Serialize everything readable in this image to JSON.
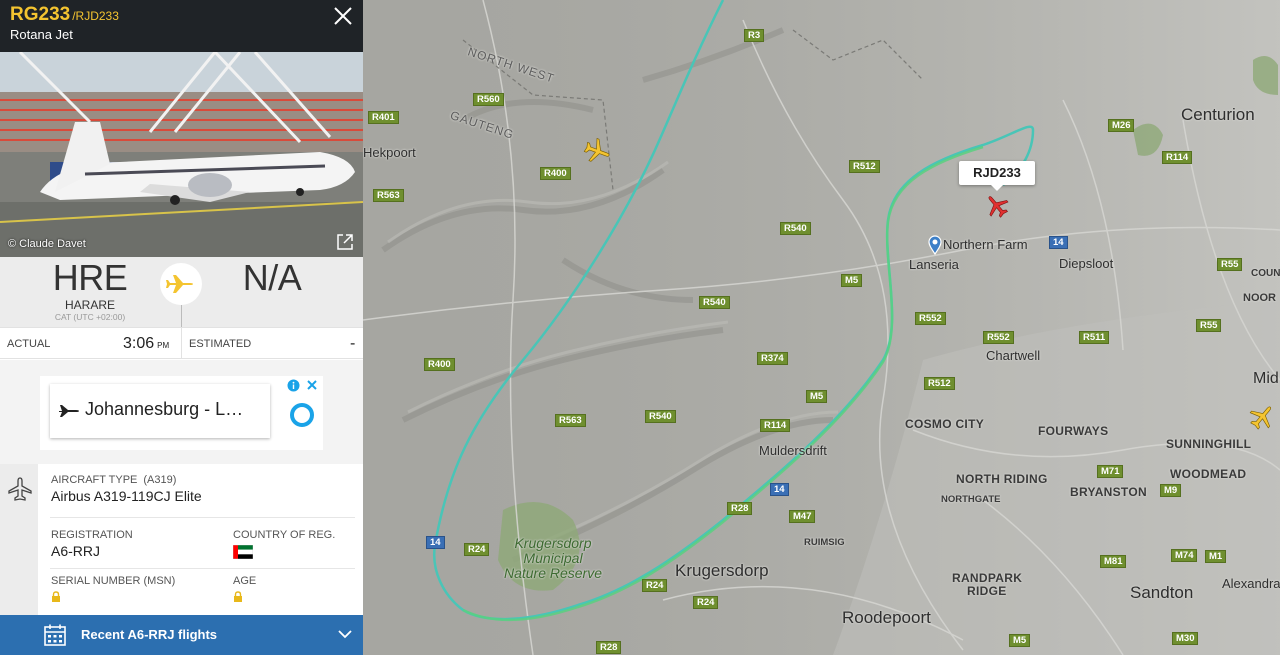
{
  "flight": {
    "number": "RG233",
    "callsign": "/RJD233",
    "airline": "Rotana Jet",
    "photo_credit": "© Claude Davet"
  },
  "route": {
    "origin_code": "HRE",
    "origin_city": "HARARE",
    "origin_tz": "CAT (UTC +02:00)",
    "destination_code": "N/A"
  },
  "times": {
    "actual_label": "ACTUAL",
    "actual_value": "3:06",
    "actual_ampm": "PM",
    "estimated_label": "ESTIMATED",
    "estimated_value": "-"
  },
  "ad": {
    "text": "Johannesburg - L…"
  },
  "aircraft": {
    "type_label": "AIRCRAFT TYPE",
    "type_code": "(A319)",
    "type_value": "Airbus A319-119CJ Elite",
    "registration_label": "REGISTRATION",
    "registration_value": "A6-RRJ",
    "country_label": "COUNTRY OF REG.",
    "serial_label": "SERIAL NUMBER (MSN)",
    "age_label": "AGE"
  },
  "recent": {
    "label": "Recent A6-RRJ flights"
  },
  "map": {
    "aircraft_tag": "RJD233",
    "places": {
      "centurion": "Centurion",
      "hekpoort": "Hekpoort",
      "northern_farm": "Northern Farm",
      "lanseria": "Lanseria",
      "diepsloot": "Diepsloot",
      "chartwell": "Chartwell",
      "cosmo_city": "COSMO CITY",
      "fourways": "FOURWAYS",
      "sunninghill": "SUNNINGHILL",
      "woodmead": "WOODMEAD",
      "muldersdrift": "Muldersdrift",
      "north_riding": "NORTH RIDING",
      "northgate": "NORTHGATE",
      "bryanston": "BRYANSTON",
      "ruimsig": "RUIMSIG",
      "krugersdorp": "Krugersdorp",
      "randpark_ridge_1": "RANDPARK",
      "randpark_ridge_2": "RIDGE",
      "alexandra": "Alexandra",
      "sandton": "Sandton",
      "roodepoort": "Roodepoort",
      "reserve_1": "Krugersdorp",
      "reserve_2": "Municipal",
      "reserve_3": "Nature Reserve",
      "north_west": "NORTH WEST",
      "gauteng": "GAUTENG",
      "edge_mid": "Mid",
      "edge_noor": "NOOR",
      "edge_coun": "COUN"
    },
    "roads": {
      "r3": "R3",
      "r560": "R560",
      "r401": "R401",
      "r563a": "R563",
      "r400a": "R400",
      "r512a": "R512",
      "m26": "M26",
      "r114a": "R114",
      "r540a": "R540",
      "m5a": "M5",
      "r540b": "R540",
      "r552a": "R552",
      "r552b": "R552",
      "r511": "R511",
      "r55a": "R55",
      "r55b": "R55",
      "r374": "R374",
      "r512b": "R512",
      "r400b": "R400",
      "m5b": "M5",
      "r540c": "R540",
      "r563b": "R563",
      "r114b": "R114",
      "n14a": "14",
      "n14b": "14",
      "n14c": "14",
      "m71": "M71",
      "m9": "M9",
      "r28a": "R28",
      "m47": "M47",
      "r24a": "R24",
      "r24b": "R24",
      "r24c": "R24",
      "m81": "M81",
      "m74": "M74",
      "m1": "M1",
      "m5c": "M5",
      "m30": "M30",
      "r28b": "R28"
    }
  }
}
